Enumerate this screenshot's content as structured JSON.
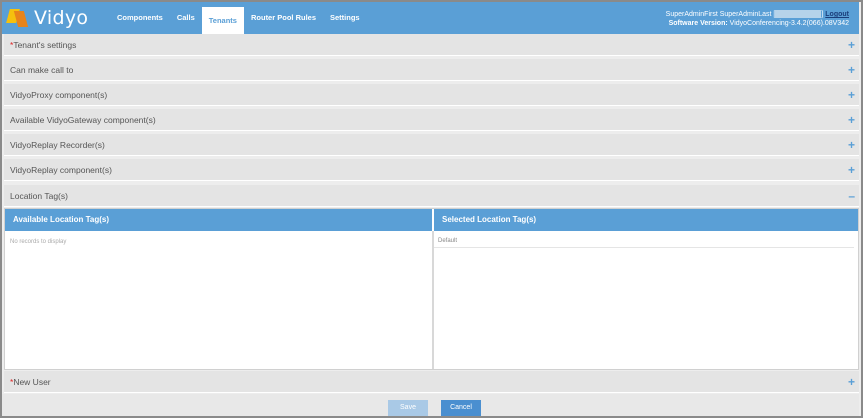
{
  "header": {
    "logo_text": "Vidyo",
    "nav": [
      "Components",
      "Calls",
      "Tenants",
      "Router Pool Rules",
      "Settings"
    ],
    "active_nav": "Tenants",
    "user_name": "SuperAdminFirst SuperAdminLast [",
    "user_close": "]",
    "logout": "Logout",
    "software_label": "Software Version:",
    "software_version": "VidyoConferencing-3.4.2(066).08V342"
  },
  "sections": {
    "tenant_settings": "Tenant's settings",
    "can_make_call": "Can make call to",
    "proxy": "VidyoProxy component(s)",
    "gateway": "Available VidyoGateway component(s)",
    "recorder": "VidyoReplay Recorder(s)",
    "replay": "VidyoReplay component(s)",
    "location_tags": "Location Tag(s)",
    "new_user": "New User"
  },
  "location": {
    "available_header": "Available Location Tag(s)",
    "selected_header": "Selected Location Tag(s)",
    "empty_text": "No records to display",
    "selected_items": [
      "Default"
    ]
  },
  "icons": {
    "expand": "+",
    "collapse": "–"
  },
  "buttons": {
    "save": "Save",
    "cancel": "Cancel"
  }
}
